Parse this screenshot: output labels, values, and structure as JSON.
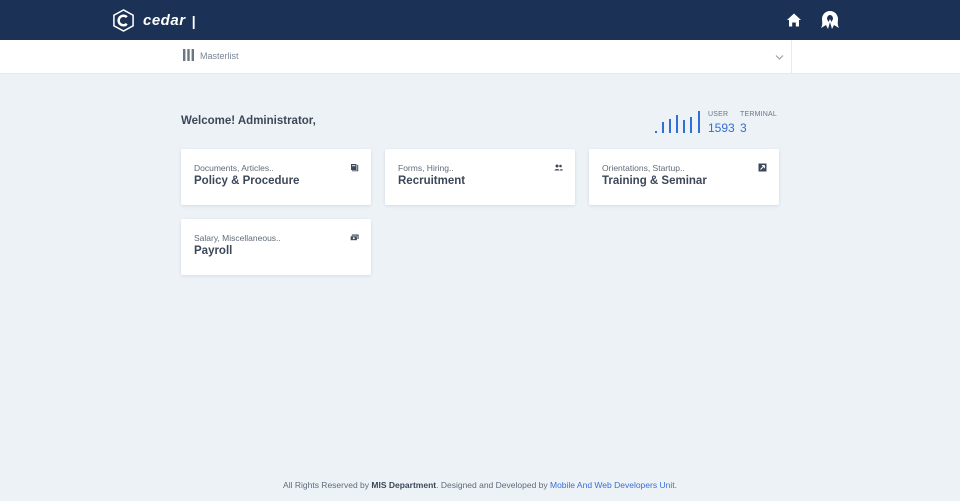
{
  "header": {
    "brand_name": "cedar",
    "brand_separator": "|",
    "icons": [
      "cedar-logo-icon",
      "home-icon",
      "user-avatar-icon"
    ],
    "colors": {
      "background": "#1b3155",
      "text": "#ffffff"
    }
  },
  "subbar": {
    "label": "Masterlist",
    "icons": [
      "columns-icon",
      "chevron-down-icon"
    ]
  },
  "welcome": "Welcome! Administrator,",
  "stats": {
    "user_label": "USER",
    "user_value": "1593",
    "terminal_label": "TERMINAL",
    "terminal_value": "3",
    "accent": "#2f6fd6"
  },
  "cards": [
    {
      "subtitle": "Documents, Articles..",
      "title": "Policy & Procedure",
      "icon": "book-icon"
    },
    {
      "subtitle": "Forms, Hiring..",
      "title": "Recruitment",
      "icon": "users-icon"
    },
    {
      "subtitle": "Orientations, Startup..",
      "title": "Training & Seminar",
      "icon": "external-link-icon"
    },
    {
      "subtitle": "Salary, Miscellaneous..",
      "title": "Payroll",
      "icon": "money-icon"
    }
  ],
  "footer": {
    "prefix": "All Rights Reserved by ",
    "department": "MIS Department",
    "middle": ". Designed and Developed by ",
    "developer": "Mobile And Web Developers Unit",
    "suffix": "."
  },
  "colors": {
    "page_background": "#edf2f7",
    "link": "#3b6fd4"
  }
}
